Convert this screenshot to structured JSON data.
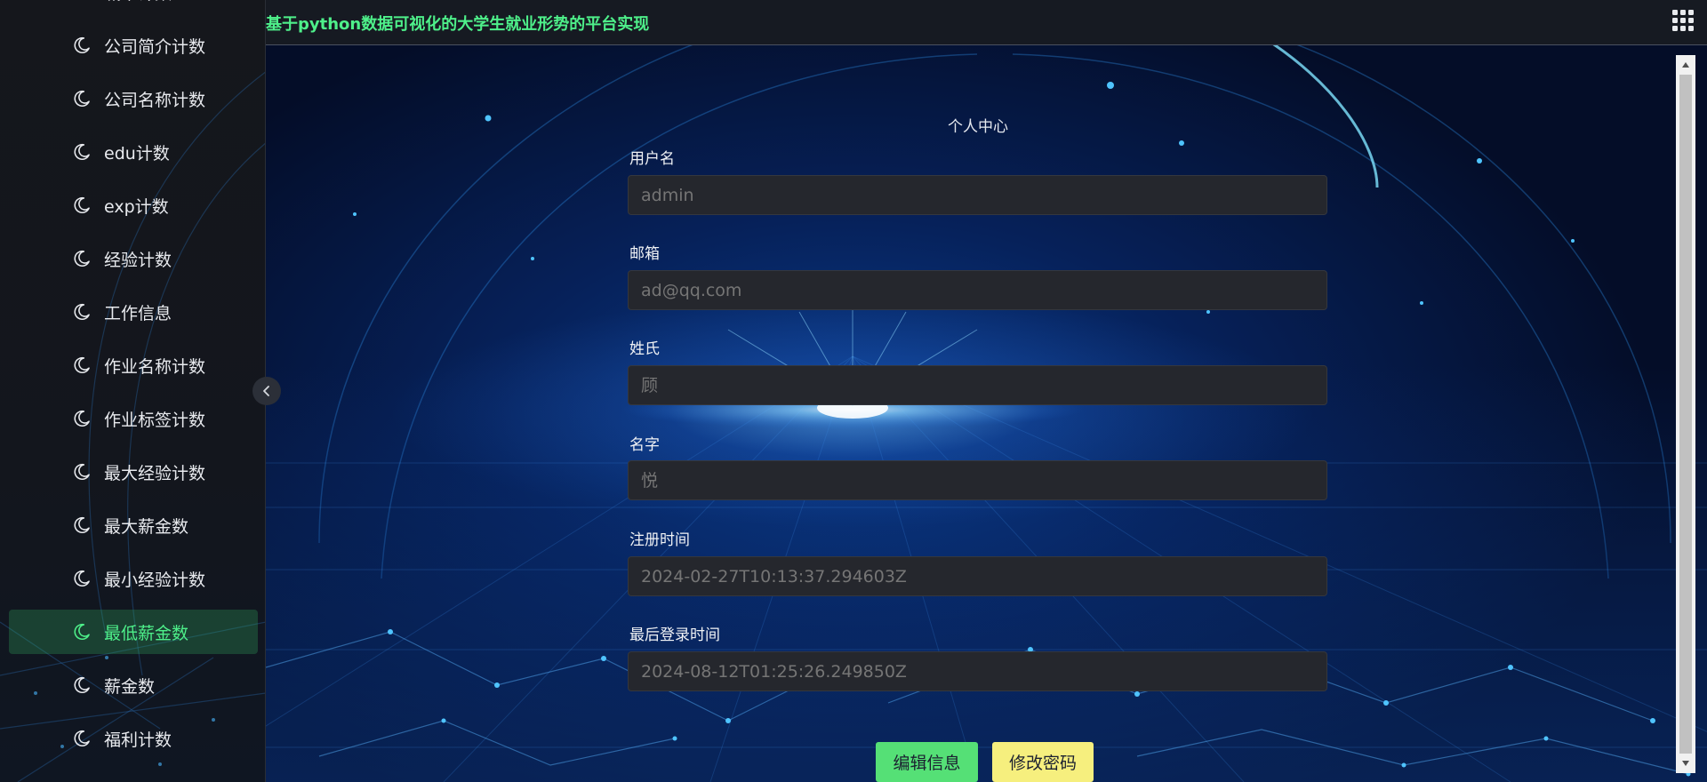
{
  "header": {
    "title": "基于python数据可视化的大学生就业形势的平台实现"
  },
  "sidebar": {
    "items": [
      {
        "label": "城市计数",
        "active": false
      },
      {
        "label": "公司简介计数",
        "active": false
      },
      {
        "label": "公司名称计数",
        "active": false
      },
      {
        "label": "edu计数",
        "active": false
      },
      {
        "label": "exp计数",
        "active": false
      },
      {
        "label": "经验计数",
        "active": false
      },
      {
        "label": "工作信息",
        "active": false
      },
      {
        "label": "作业名称计数",
        "active": false
      },
      {
        "label": "作业标签计数",
        "active": false
      },
      {
        "label": "最大经验计数",
        "active": false
      },
      {
        "label": "最大薪金数",
        "active": false
      },
      {
        "label": "最小经验计数",
        "active": false
      },
      {
        "label": "最低薪金数",
        "active": true
      },
      {
        "label": "薪金数",
        "active": false
      },
      {
        "label": "福利计数",
        "active": false
      }
    ]
  },
  "profile": {
    "title": "个人中心",
    "fields": [
      {
        "label": "用户名",
        "placeholder": "admin"
      },
      {
        "label": "邮箱",
        "placeholder": "ad@qq.com"
      },
      {
        "label": "姓氏",
        "placeholder": "顾"
      },
      {
        "label": "名字",
        "placeholder": "悦"
      },
      {
        "label": "注册时间",
        "placeholder": "2024-02-27T10:13:37.294603Z"
      },
      {
        "label": "最后登录时间",
        "placeholder": "2024-08-12T01:25:26.249850Z"
      }
    ],
    "edit_button": "编辑信息",
    "password_button": "修改密码"
  },
  "colors": {
    "accent": "#4ef08a",
    "edit_button": "#55e076",
    "password_button": "#f6ef7e",
    "input_bg": "#25272d"
  },
  "icons": {
    "menu_item": "moon-icon",
    "collapse": "chevron-left-icon",
    "apps": "grid-icon"
  }
}
